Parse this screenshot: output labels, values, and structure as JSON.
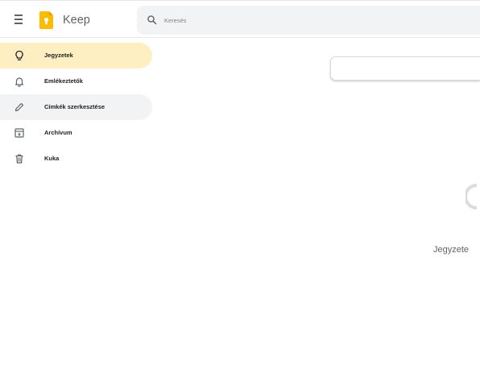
{
  "header": {
    "app_name": "Keep",
    "search_placeholder": "Keresés"
  },
  "sidebar": {
    "items": [
      {
        "label": "Jegyzetek",
        "icon": "lightbulb-icon",
        "state": "active"
      },
      {
        "label": "Emlékeztetők",
        "icon": "bell-icon",
        "state": "normal"
      },
      {
        "label": "Címkék szerkesztése",
        "icon": "pencil-icon",
        "state": "hover"
      },
      {
        "label": "Archívum",
        "icon": "archive-icon",
        "state": "normal"
      },
      {
        "label": "Kuka",
        "icon": "trash-icon",
        "state": "normal"
      }
    ]
  },
  "main": {
    "empty_text": "Jegyzete"
  },
  "colors": {
    "active_bg": "#feefc3",
    "hover_bg": "#f1f3f4",
    "logo": "#fbbc04"
  }
}
